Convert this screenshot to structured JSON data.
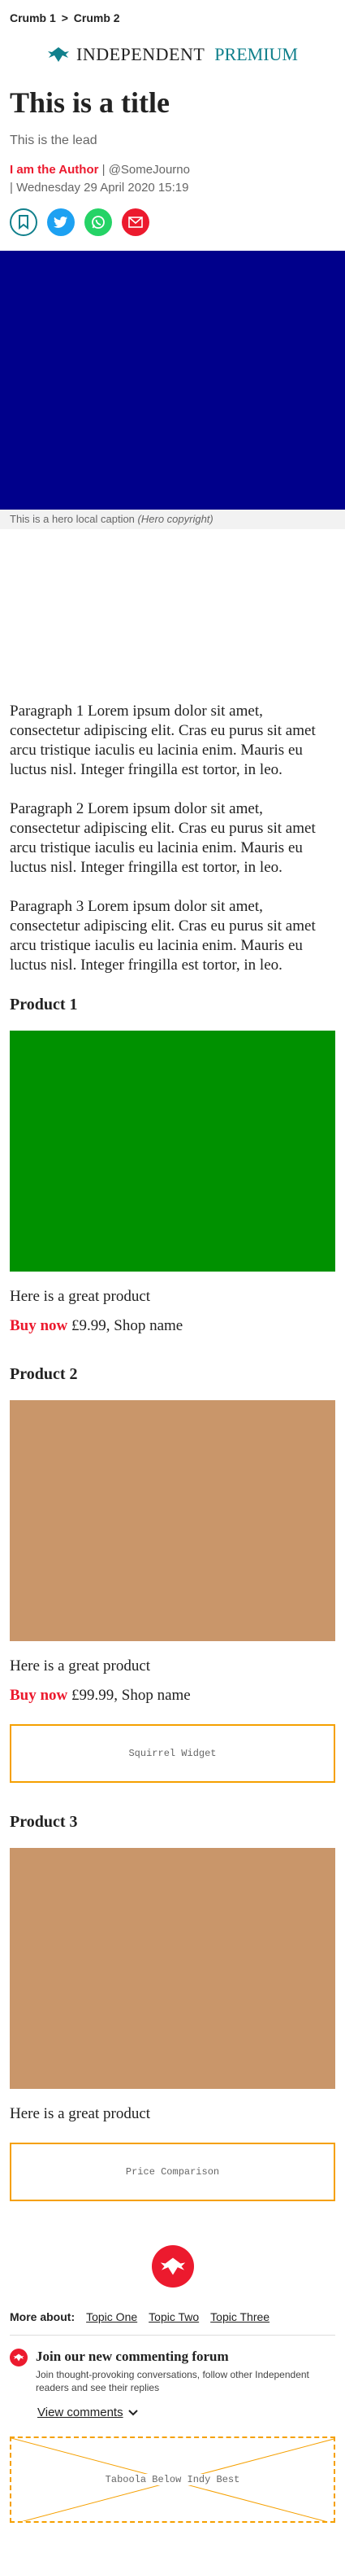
{
  "breadcrumb": {
    "crumb1": "Crumb 1",
    "separator": ">",
    "crumb2": "Crumb 2"
  },
  "masthead": {
    "brand": "INDEPENDENT",
    "premium": "PREMIUM"
  },
  "article": {
    "title": "This is a title",
    "lead": "This is the lead",
    "author": "I am the Author",
    "handle": "@SomeJourno",
    "date": "Wednesday 29 April 2020 15:19",
    "hero_caption": "This is a hero local caption",
    "hero_copyright": "(Hero copyright)",
    "paragraphs": [
      "Paragraph 1 Lorem ipsum dolor sit amet, consectetur adipiscing elit. Cras eu purus sit amet arcu tristique iaculis eu lacinia enim. Mauris eu luctus nisl. Integer fringilla est tortor, in leo.",
      "Paragraph 2 Lorem ipsum dolor sit amet, consectetur adipiscing elit. Cras eu purus sit amet arcu tristique iaculis eu lacinia enim. Mauris eu luctus nisl. Integer fringilla est tortor, in leo.",
      "Paragraph 3 Lorem ipsum dolor sit amet, consectetur adipiscing elit. Cras eu purus sit amet arcu tristique iaculis eu lacinia enim. Mauris eu luctus nisl. Integer fringilla est tortor, in leo."
    ]
  },
  "share_icons": [
    "bookmark-icon",
    "twitter-icon",
    "whatsapp-icon",
    "email-icon"
  ],
  "products": [
    {
      "name": "Product 1",
      "desc": "Here is a great product",
      "buy": "Buy now",
      "price": "£9.99",
      "shop": ", Shop name",
      "color": "#009100"
    },
    {
      "name": "Product 2",
      "desc": "Here is a great product",
      "buy": "Buy now",
      "price": "£99.99",
      "shop": ", Shop name",
      "color": "#c9966a"
    },
    {
      "name": "Product 3",
      "desc": "Here is a great product",
      "color": "#c9966a"
    }
  ],
  "widgets": {
    "squirrel": "Squirrel Widget",
    "price_comparison": "Price Comparison",
    "taboola": "Taboola Below Indy Best"
  },
  "more_about": {
    "label": "More about:",
    "topics": [
      "Topic One",
      "Topic Two",
      "Topic Three"
    ]
  },
  "comments": {
    "heading": "Join our new commenting forum",
    "text": "Join thought-provoking conversations, follow other Independent readers and see their replies",
    "view": "View comments"
  },
  "colors": {
    "accent": "#ec1a2e",
    "premium": "#11808c",
    "hero": "#00008b",
    "widget_border": "#f5a000"
  }
}
